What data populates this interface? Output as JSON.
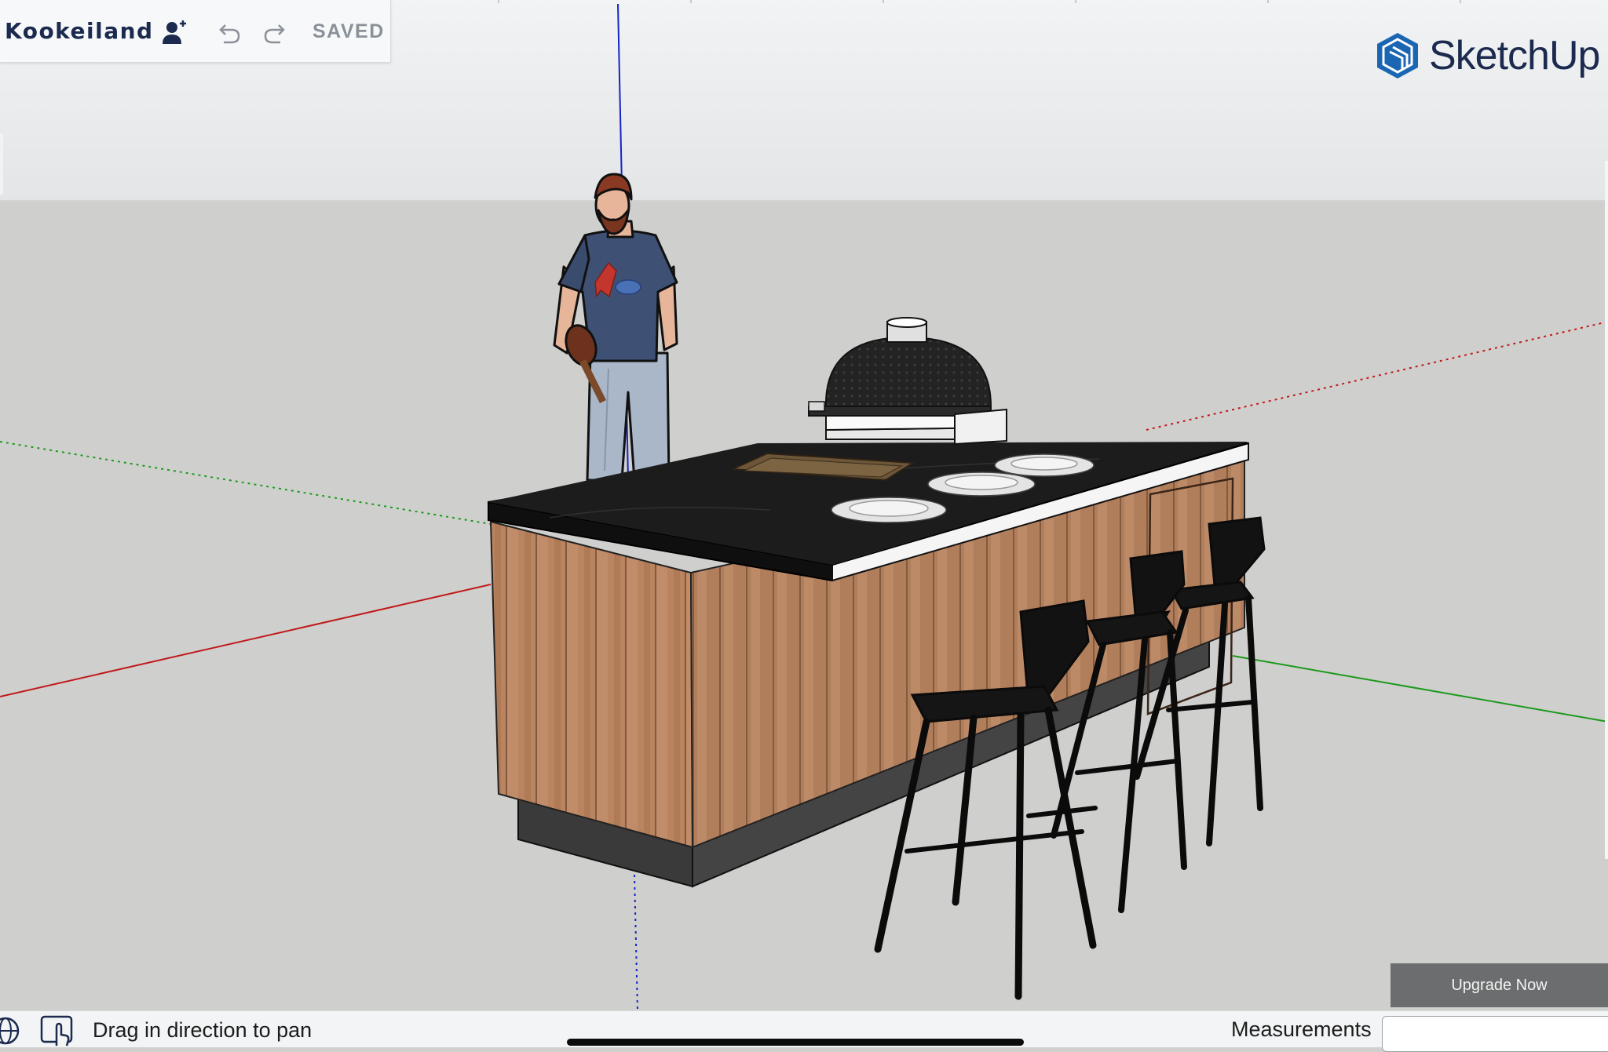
{
  "app": {
    "name": "SketchUp",
    "model_title": "Kookeiland",
    "save_state": "SAVED"
  },
  "toolbar": {
    "icons": [
      "add-collaborator-icon",
      "undo-icon",
      "redo-icon"
    ]
  },
  "upgrade": {
    "label": "Upgrade Now"
  },
  "statusbar": {
    "hint": "Drag in direction to pan",
    "measurements_label": "Measurements",
    "measurements_value": ""
  },
  "colors": {
    "brand_navy": "#1b2a4e",
    "sky": "#e9ebed",
    "ground": "#cfcfcd",
    "axis_red": "#c0191b",
    "axis_green": "#1c9a1c",
    "axis_blue": "#1525c6",
    "wood": "#b5825f",
    "countertop": "#161616"
  }
}
